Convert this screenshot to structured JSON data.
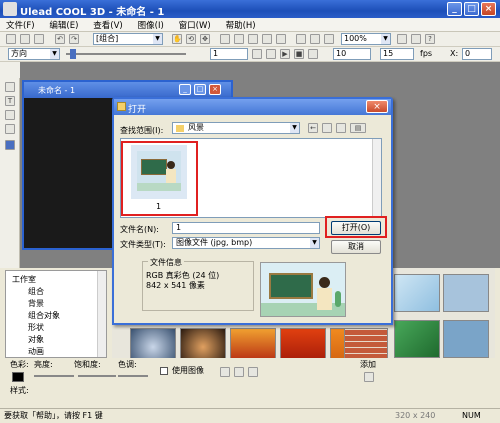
{
  "app": {
    "title": "Ulead COOL 3D - 未命名 - 1",
    "menu": [
      "文件(F)",
      "编辑(E)",
      "查看(V)",
      "图像(I)",
      "窗口(W)",
      "帮助(H)"
    ]
  },
  "toolbar1": {
    "group_combo": "[组合]",
    "zoom_combo": "100%"
  },
  "toolbar2": {
    "direction_combo": "方向",
    "frame_value": "1",
    "fps_value": "15",
    "fps_label": "fps",
    "x_label": "X:",
    "x_value": "0",
    "speed_value": "10"
  },
  "document": {
    "title": "未命名 - 1"
  },
  "tree": {
    "items": [
      "工作室",
      "组合",
      "背景",
      "组合对象",
      "形状",
      "对象",
      "动画"
    ]
  },
  "bottom": {
    "color_label": "色彩:",
    "brightness_label": "亮度:",
    "saturation_label": "饱和度:",
    "hue_label": "色调:",
    "use_image_label": "使用图像",
    "add_label": "添加",
    "style_label": "样式:"
  },
  "status": {
    "help_text": "要获取「帮助」，请按 F1 键",
    "dimensions": "320 x 240",
    "num": "NUM"
  },
  "dialog": {
    "title": "打开",
    "lookin_label": "查找范围(I):",
    "lookin_value": "风景",
    "thumb_caption": "1",
    "filename_label": "文件名(N):",
    "filename_value": "1",
    "filetype_label": "文件类型(T):",
    "filetype_value": "图像文件 (jpg, bmp)",
    "open_button": "打开(O)",
    "cancel_button": "取消",
    "fileinfo_title": "文件信息",
    "fileinfo_line1": "RGB 真彩色 (24 位)",
    "fileinfo_line2": "842 x 541 像素"
  },
  "colors": {
    "highlight": "#e02020",
    "titlebar": "#2a5cc8",
    "chalkboard": "#2f6b4a"
  }
}
